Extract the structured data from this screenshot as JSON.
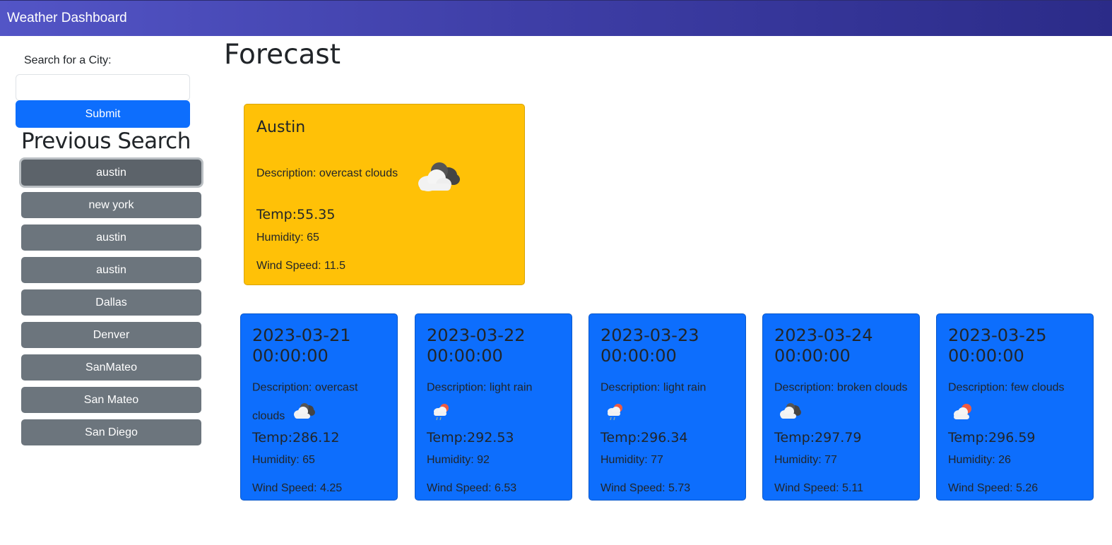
{
  "header": {
    "title": "Weather Dashboard"
  },
  "sidebar": {
    "search_label": "Search for a City:",
    "search_value": "",
    "submit_label": "Submit",
    "previous_title": "Previous Search",
    "history": [
      "austin",
      "new york",
      "austin",
      "austin",
      "Dallas",
      "Denver",
      "SanMateo",
      "San Mateo",
      "San Diego"
    ]
  },
  "main": {
    "title": "Forecast",
    "current": {
      "city": "Austin",
      "description": "Description: overcast clouds",
      "icon": "overcast-clouds-icon",
      "temp": "Temp:55.35",
      "humidity": "Humidity: 65",
      "wind": "Wind Speed: 11.5"
    },
    "forecast": [
      {
        "date": "2023-03-21 00:00:00",
        "description": "Description: overcast clouds",
        "icon": "overcast-clouds-icon",
        "temp": "Temp:286.12",
        "humidity": "Humidity: 65",
        "wind": "Wind Speed: 4.25"
      },
      {
        "date": "2023-03-22 00:00:00",
        "description": "Description: light rain",
        "icon": "light-rain-icon",
        "temp": "Temp:292.53",
        "humidity": "Humidity: 92",
        "wind": "Wind Speed: 6.53"
      },
      {
        "date": "2023-03-23 00:00:00",
        "description": "Description: light rain",
        "icon": "light-rain-icon",
        "temp": "Temp:296.34",
        "humidity": "Humidity: 77",
        "wind": "Wind Speed: 5.73"
      },
      {
        "date": "2023-03-24 00:00:00",
        "description": "Description: broken clouds",
        "icon": "broken-clouds-icon",
        "temp": "Temp:297.79",
        "humidity": "Humidity: 77",
        "wind": "Wind Speed: 5.11"
      },
      {
        "date": "2023-03-25 00:00:00",
        "description": "Description: few clouds",
        "icon": "few-clouds-icon",
        "temp": "Temp:296.59",
        "humidity": "Humidity: 26",
        "wind": "Wind Speed: 5.26"
      }
    ]
  },
  "colors": {
    "header_start": "#5355c6",
    "header_end": "#2b2b88",
    "primary": "#0d6efd",
    "warning": "#ffc107",
    "secondary": "#6c757d"
  }
}
